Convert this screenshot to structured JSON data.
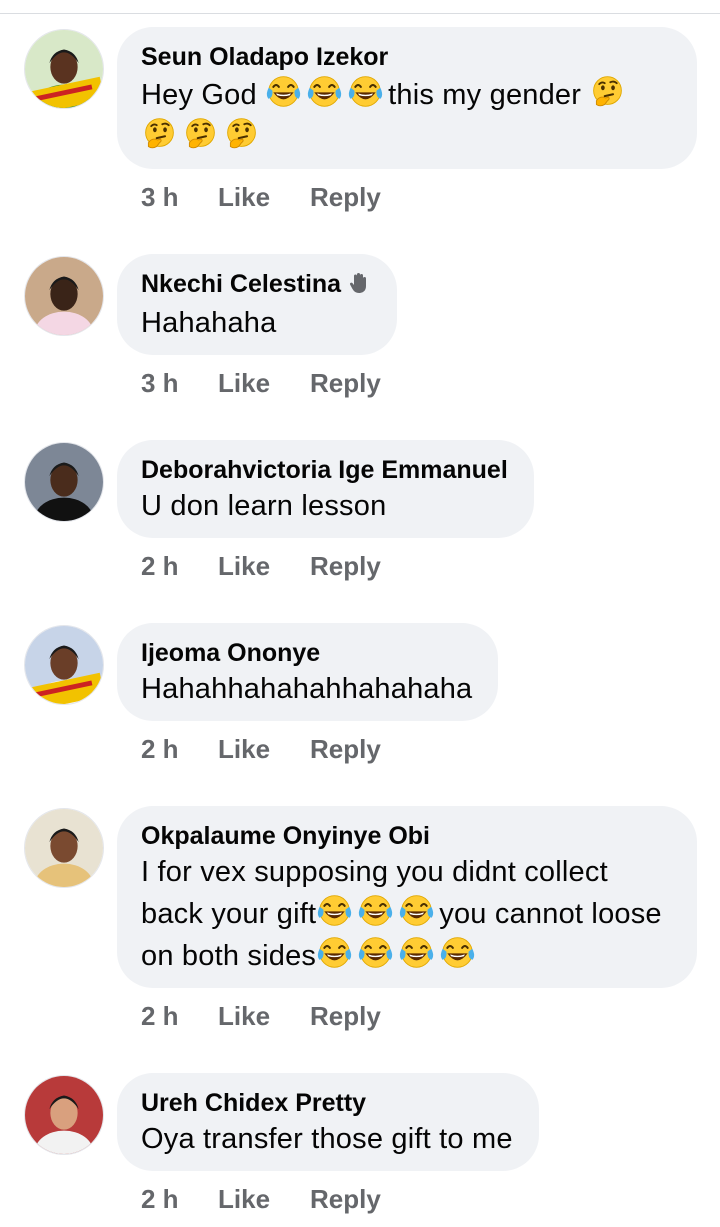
{
  "comments": [
    {
      "author": "Seun Oladapo Izekor",
      "avatar": "avatar-seun",
      "segments": [
        {
          "t": "text",
          "v": "Hey God "
        },
        {
          "t": "emoji",
          "name": "tears-of-joy"
        },
        {
          "t": "emoji",
          "name": "tears-of-joy"
        },
        {
          "t": "emoji",
          "name": "tears-of-joy"
        },
        {
          "t": "text",
          "v": "this my gender "
        },
        {
          "t": "emoji",
          "name": "thinking"
        },
        {
          "t": "emoji",
          "name": "thinking"
        },
        {
          "t": "emoji",
          "name": "thinking"
        },
        {
          "t": "emoji",
          "name": "thinking"
        }
      ],
      "time": "3 h",
      "like": "Like",
      "reply": "Reply"
    },
    {
      "author": "Nkechi Celestina",
      "author_badge": "waving-hand-icon",
      "avatar": "avatar-nkechi",
      "segments": [
        {
          "t": "text",
          "v": "Hahahaha"
        }
      ],
      "time": "3 h",
      "like": "Like",
      "reply": "Reply"
    },
    {
      "author": "Deborahvictoria Ige Emmanuel",
      "avatar": "avatar-deborah",
      "segments": [
        {
          "t": "text",
          "v": "U don learn lesson"
        }
      ],
      "time": "2 h",
      "like": "Like",
      "reply": "Reply"
    },
    {
      "author": "Ijeoma Ononye",
      "avatar": "avatar-ijeoma",
      "segments": [
        {
          "t": "text",
          "v": "Hahahhahahahhahahaha"
        }
      ],
      "time": "2 h",
      "like": "Like",
      "reply": "Reply"
    },
    {
      "author": "Okpalaume Onyinye Obi",
      "avatar": "avatar-okpalaume",
      "segments": [
        {
          "t": "text",
          "v": "I for vex supposing you didnt collect back your gift"
        },
        {
          "t": "emoji",
          "name": "tears-of-joy"
        },
        {
          "t": "emoji",
          "name": "tears-of-joy"
        },
        {
          "t": "emoji",
          "name": "tears-of-joy"
        },
        {
          "t": "text",
          "v": "you cannot loose on both sides"
        },
        {
          "t": "emoji",
          "name": "tears-of-joy"
        },
        {
          "t": "emoji",
          "name": "tears-of-joy"
        },
        {
          "t": "emoji",
          "name": "tears-of-joy"
        },
        {
          "t": "emoji",
          "name": "tears-of-joy"
        }
      ],
      "time": "2 h",
      "like": "Like",
      "reply": "Reply"
    },
    {
      "author": "Ureh Chidex Pretty",
      "avatar": "avatar-ureh",
      "segments": [
        {
          "t": "text",
          "v": "Oya transfer those gift to me"
        }
      ],
      "time": "2 h",
      "like": "Like",
      "reply": "Reply"
    }
  ]
}
